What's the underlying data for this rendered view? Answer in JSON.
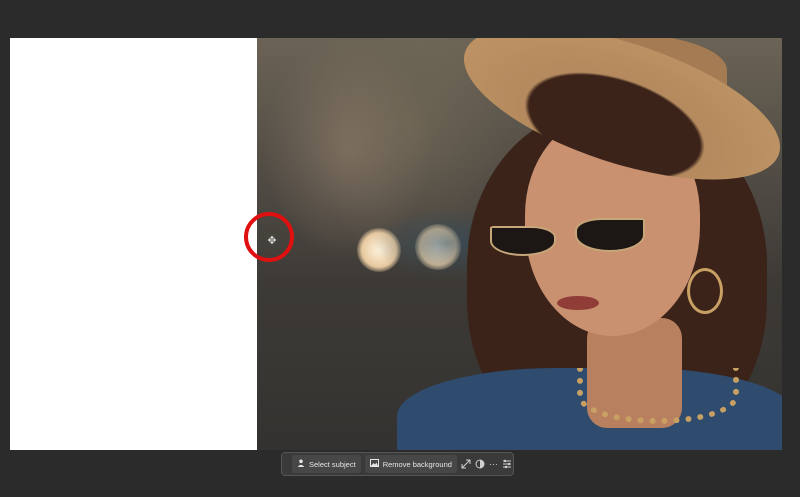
{
  "toolbar": {
    "select_subject_label": "Select subject",
    "remove_background_label": "Remove background",
    "more_label": "···"
  },
  "icons": {
    "select_subject": "person-icon",
    "remove_background": "image-icon",
    "transform": "transform-icon",
    "adjust": "circle-half-icon",
    "more": "more-icon",
    "settings": "sliders-icon"
  },
  "colors": {
    "workspace_bg": "#2b2b2b",
    "highlight_ring": "#e01010",
    "taskbar_bg": "#3a3a3a"
  }
}
